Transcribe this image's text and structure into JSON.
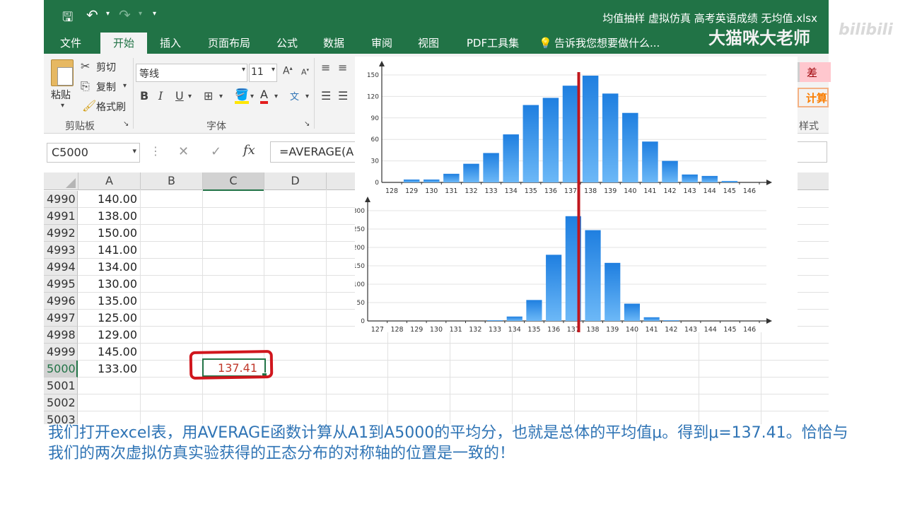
{
  "window": {
    "title": "均值抽样 虚拟仿真 高考英语成绩 无均值.xlsx",
    "watermark": "大猫咪大老师",
    "site_logo": "bilibili"
  },
  "tabs": [
    "文件",
    "开始",
    "插入",
    "页面布局",
    "公式",
    "数据",
    "审阅",
    "视图",
    "PDF工具集"
  ],
  "tell_me": "告诉我您想要做什么...",
  "ribbon": {
    "paste": "粘贴",
    "cut": "剪切",
    "copy": "复制",
    "format_painter": "格式刷",
    "clipboard_group": "剪贴板",
    "font_name": "等线",
    "font_size": "11",
    "bold": "B",
    "italic": "I",
    "underline": "U",
    "font_group": "字体",
    "style_bad": "差",
    "style_calc": "计算",
    "styles_group": "样式"
  },
  "formula_bar": {
    "name_box": "C5000",
    "fx": "fx",
    "formula": "=AVERAGE(A"
  },
  "columns": [
    "A",
    "B",
    "C",
    "D"
  ],
  "rows": [
    {
      "n": "4990",
      "a": "140.00"
    },
    {
      "n": "4991",
      "a": "138.00"
    },
    {
      "n": "4992",
      "a": "150.00"
    },
    {
      "n": "4993",
      "a": "141.00"
    },
    {
      "n": "4994",
      "a": "134.00"
    },
    {
      "n": "4995",
      "a": "130.00"
    },
    {
      "n": "4996",
      "a": "135.00"
    },
    {
      "n": "4997",
      "a": "125.00"
    },
    {
      "n": "4998",
      "a": "129.00"
    },
    {
      "n": "4999",
      "a": "145.00"
    },
    {
      "n": "5000",
      "a": "133.00"
    },
    {
      "n": "5001",
      "a": ""
    },
    {
      "n": "5002",
      "a": ""
    },
    {
      "n": "5003",
      "a": ""
    }
  ],
  "selected_value": "137.41",
  "caption": "我们打开excel表，用AVERAGE函数计算从A1到A5000的平均分，也就是总体的平均值μ。得到μ=137.41。恰恰与我们的两次虚拟仿真实验获得的正态分布的对称轴的位置是一致的！",
  "colors": {
    "excel_green": "#217346",
    "bar": "#2f8fe8",
    "mean_line": "#c0171d",
    "caption": "#2f74b5"
  },
  "chart_data": [
    {
      "type": "bar",
      "categories": [
        "128",
        "129",
        "130",
        "131",
        "132",
        "133",
        "134",
        "135",
        "136",
        "137",
        "138",
        "139",
        "140",
        "141",
        "142",
        "143",
        "144",
        "145",
        "146"
      ],
      "values": [
        0,
        4,
        4,
        12,
        26,
        41,
        67,
        108,
        118,
        135,
        149,
        124,
        97,
        57,
        30,
        11,
        9,
        2,
        0
      ],
      "yticks": [
        0,
        30,
        60,
        90,
        120,
        150
      ],
      "ylim": [
        0,
        150
      ]
    },
    {
      "type": "bar",
      "categories": [
        "127",
        "128",
        "129",
        "130",
        "131",
        "132",
        "133",
        "134",
        "135",
        "136",
        "137",
        "138",
        "139",
        "140",
        "141",
        "142",
        "143",
        "144",
        "145",
        "146"
      ],
      "values": [
        0,
        0,
        0,
        0,
        0,
        0,
        2,
        12,
        57,
        180,
        285,
        247,
        158,
        47,
        10,
        2,
        0,
        0,
        0,
        0
      ],
      "yticks": [
        0,
        50,
        100,
        150,
        200,
        250,
        300
      ],
      "ylim": [
        0,
        300
      ]
    }
  ],
  "mean_marker": 137.41
}
